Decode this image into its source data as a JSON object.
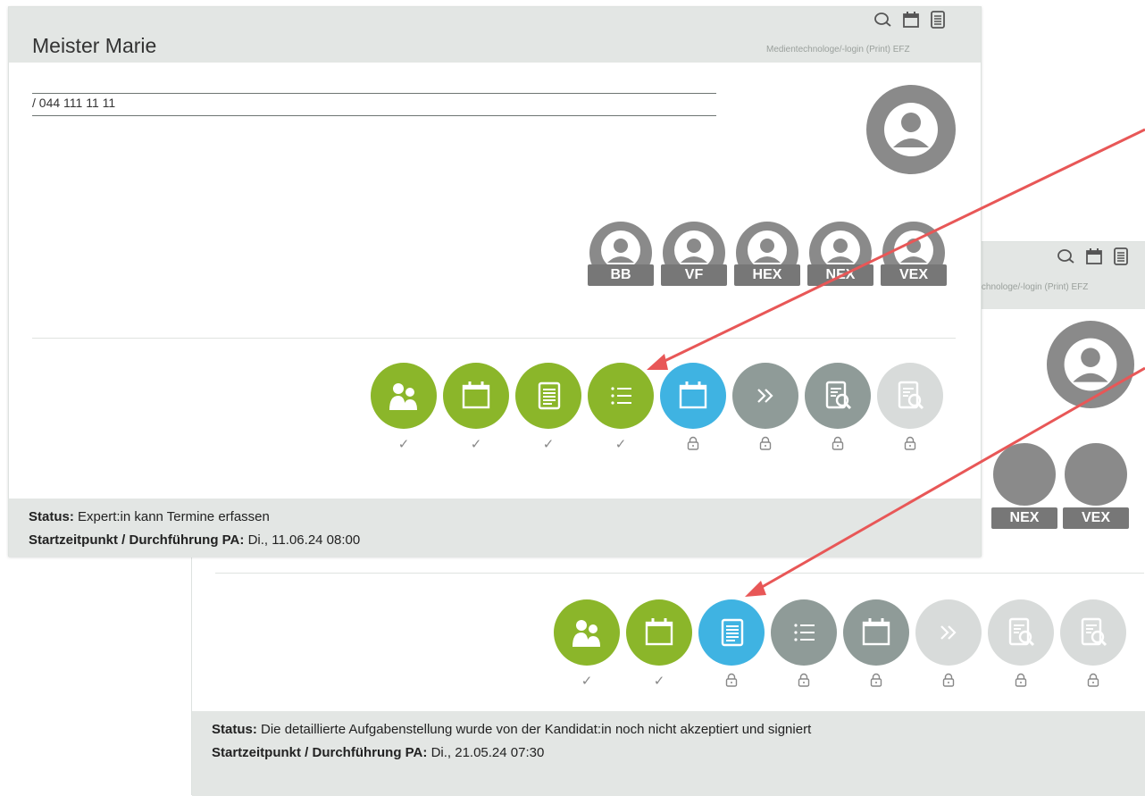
{
  "front": {
    "name": "Meister Marie",
    "profession": "Medientechnologe/-login (Print) EFZ",
    "phone": "/ 044 111 11 11",
    "header_icons": [
      "chat-icon",
      "calendar-icon",
      "document-icon"
    ],
    "roles": [
      "BB",
      "VF",
      "HEX",
      "NEX",
      "VEX"
    ],
    "steps": [
      {
        "icon": "people-icon",
        "color": "green",
        "mark": "✓"
      },
      {
        "icon": "calendar-icon",
        "color": "green",
        "mark": "✓"
      },
      {
        "icon": "document-icon",
        "color": "green",
        "mark": "✓"
      },
      {
        "icon": "list-icon",
        "color": "green",
        "mark": "✓"
      },
      {
        "icon": "calendar-icon",
        "color": "blue",
        "mark": "lock"
      },
      {
        "icon": "forward-icon",
        "color": "grey",
        "mark": "lock"
      },
      {
        "icon": "review-icon",
        "color": "grey",
        "mark": "lock"
      },
      {
        "icon": "review-icon",
        "color": "light",
        "mark": "lock"
      }
    ],
    "status_label": "Status:",
    "status_text": "Expert:in kann Termine erfassen",
    "start_label": "Startzeitpunkt / Durchführung PA:",
    "start_text": "Di., 11.06.24 08:00"
  },
  "back": {
    "profession": "ntechnologe/-login (Print) EFZ",
    "roles": [
      "NEX",
      "VEX"
    ],
    "steps": [
      {
        "icon": "people-icon",
        "color": "green",
        "mark": "✓"
      },
      {
        "icon": "calendar-icon",
        "color": "green",
        "mark": "✓"
      },
      {
        "icon": "document-icon",
        "color": "blue",
        "mark": "lock"
      },
      {
        "icon": "list-icon",
        "color": "grey",
        "mark": "lock"
      },
      {
        "icon": "calendar-icon",
        "color": "grey",
        "mark": "lock"
      },
      {
        "icon": "forward-icon",
        "color": "light",
        "mark": "lock"
      },
      {
        "icon": "review-icon",
        "color": "light",
        "mark": "lock"
      },
      {
        "icon": "review-icon",
        "color": "light",
        "mark": "lock"
      }
    ],
    "status_label": "Status:",
    "status_text": "Die detaillierte Aufgabenstellung wurde von der Kandidat:in noch nicht akzeptiert und signiert",
    "start_label": "Startzeitpunkt / Durchführung PA:",
    "start_text": "Di., 21.05.24 07:30"
  },
  "colors": {
    "green": "#8bb62a",
    "blue": "#3fb3e2",
    "grey": "#8f9b98",
    "light": "#d8dbda",
    "arrow": "#e85757"
  }
}
